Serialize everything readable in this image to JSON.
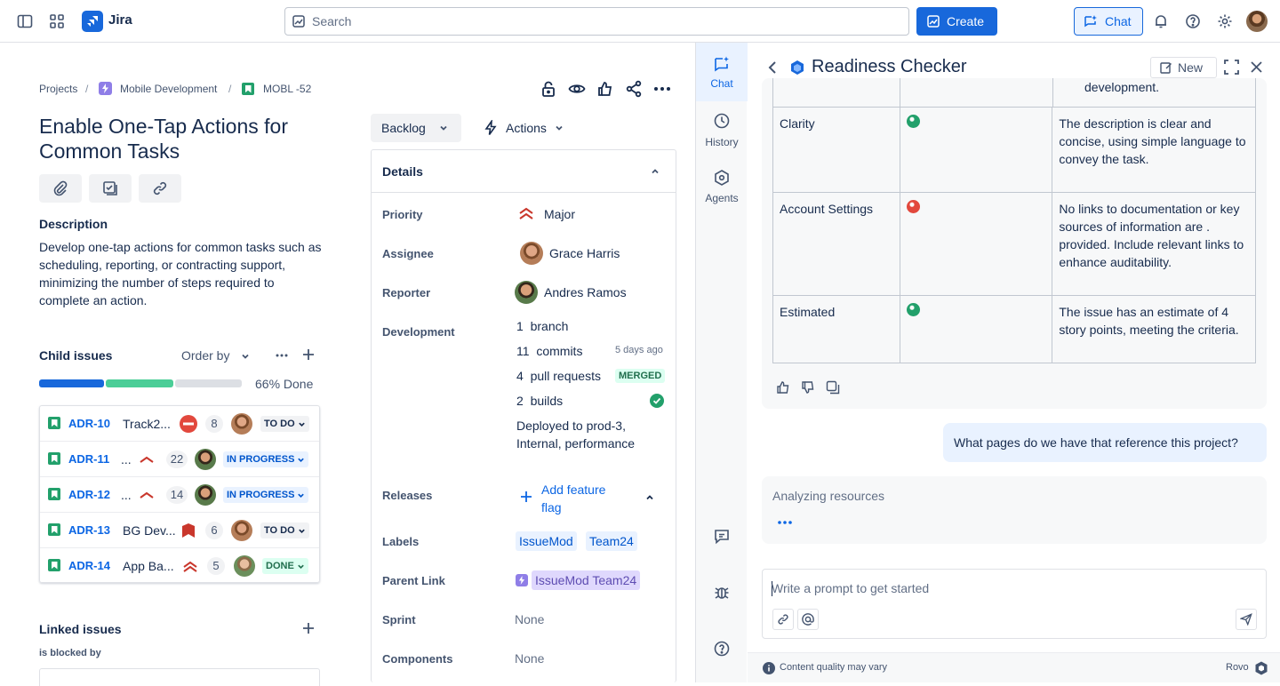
{
  "app": {
    "name": "Jira"
  },
  "topbar": {
    "search_placeholder": "Search",
    "create_label": "Create",
    "chat_label": "Chat"
  },
  "breadcrumb": {
    "projects": "Projects",
    "project": "Mobile Development",
    "issue_key": "MOBL -52"
  },
  "issue": {
    "title": "Enable One-Tap Actions for Common Tasks",
    "description_heading": "Description",
    "description": "Develop one-tap actions for common tasks such as scheduling, reporting, or contracting support, minimizing the number of steps required to complete an action."
  },
  "child_issues": {
    "heading": "Child issues",
    "order_by": "Order by",
    "progress_text": "66% Done",
    "progress": {
      "done": 0.33,
      "in_progress": 0.34,
      "todo": 0.33
    },
    "colors": {
      "done": "#1868db",
      "in_progress": "#4bce97",
      "todo": "#dcdfe4"
    },
    "items": [
      {
        "key": "ADR-10",
        "summary": "Track2...",
        "priority": "blocker",
        "count": "8",
        "status": "TO DO"
      },
      {
        "key": "ADR-11",
        "summary": "...",
        "priority": "major",
        "count": "22",
        "status": "IN PROGRESS"
      },
      {
        "key": "ADR-12",
        "summary": "...",
        "priority": "major",
        "count": "14",
        "status": "IN PROGRESS"
      },
      {
        "key": "ADR-13",
        "summary": "BG Dev...",
        "priority": "critical",
        "count": "6",
        "status": "TO DO"
      },
      {
        "key": "ADR-14",
        "summary": "App Ba...",
        "priority": "major-double",
        "count": "5",
        "status": "DONE"
      }
    ]
  },
  "linked_issues": {
    "heading": "Linked issues",
    "relation": "is blocked by"
  },
  "status_button": {
    "label": "Backlog"
  },
  "actions_button": {
    "label": "Actions"
  },
  "details": {
    "heading": "Details",
    "priority": {
      "label": "Priority",
      "value": "Major"
    },
    "assignee": {
      "label": "Assignee",
      "value": "Grace Harris"
    },
    "reporter": {
      "label": "Reporter",
      "value": "Andres Ramos"
    },
    "development": {
      "label": "Development",
      "branch_count": "1",
      "branch_label": "branch",
      "commits_count": "11",
      "commits_label": "commits",
      "commits_time": "5 days ago",
      "pr_count": "4",
      "pr_label": "pull requests",
      "pr_status": "MERGED",
      "builds_count": "2",
      "builds_label": "builds",
      "deployed": "Deployed to prod-3, Internal, performance"
    },
    "releases": {
      "label": "Releases",
      "action": "Add feature flag"
    },
    "labels": {
      "label": "Labels",
      "values": [
        "IssueMod",
        "Team24"
      ]
    },
    "parent_link": {
      "label": "Parent Link",
      "value": "IssueMod Team24"
    },
    "sprint": {
      "label": "Sprint",
      "value": "None"
    },
    "components": {
      "label": "Components",
      "value": "None"
    }
  },
  "rail": {
    "chat": "Chat",
    "history": "History",
    "agents": "Agents"
  },
  "chat_panel": {
    "title": "Readiness Checker",
    "new_label": "New",
    "table": [
      {
        "criterion": "Clarity",
        "status_color": "#22a06b",
        "note": "The description is clear and concise, using simple language to convey the task."
      },
      {
        "criterion": "Account Settings",
        "status_color": "#e2483d",
        "note": "No links to documentation or key sources of information are . provided. Include relevant links to enhance auditability."
      },
      {
        "criterion": "Estimated",
        "status_color": "#22a06b",
        "note": "The issue has an estimate of 4 story points, meeting the criteria."
      }
    ],
    "top_fragment": "development.",
    "user_message": "What pages do we have that reference this project?",
    "analyzing": "Analyzing resources",
    "prompt_placeholder": "Write a prompt to get started",
    "footer_note": "Content quality may vary",
    "footer_brand": "Rovo"
  }
}
